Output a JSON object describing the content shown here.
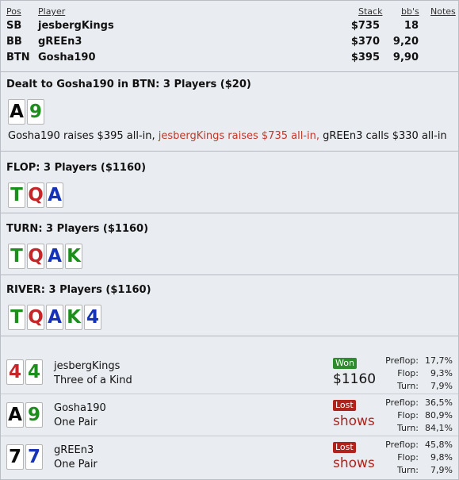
{
  "headers": {
    "pos": "Pos",
    "player": "Player",
    "stack": "Stack",
    "bbs": "bb's",
    "notes": "Notes"
  },
  "players": [
    {
      "pos": "SB",
      "name": "jesbergKings",
      "stack": "$735",
      "bbs": "18"
    },
    {
      "pos": "BB",
      "name": "gREEn3",
      "stack": "$370",
      "bbs": "9,20"
    },
    {
      "pos": "BTN",
      "name": "Gosha190",
      "stack": "$395",
      "bbs": "9,90"
    }
  ],
  "preflop": {
    "title": "Dealt to Gosha190 in BTN: 3 Players ($20)",
    "cards": [
      {
        "rank": "A",
        "color": "black"
      },
      {
        "rank": "9",
        "color": "green"
      }
    ],
    "actions": [
      {
        "text": "Gosha190 raises $395 all-in, ",
        "style": "normal"
      },
      {
        "text": "jesbergKings raises $735 all-in, ",
        "style": "red"
      },
      {
        "text": "gREEn3 calls $330 all-in",
        "style": "normal"
      }
    ]
  },
  "flop": {
    "title": "FLOP: 3 Players ($1160)",
    "cards": [
      {
        "rank": "T",
        "color": "green"
      },
      {
        "rank": "Q",
        "color": "red"
      },
      {
        "rank": "A",
        "color": "blue"
      }
    ]
  },
  "turn": {
    "title": "TURN: 3 Players ($1160)",
    "cards": [
      {
        "rank": "T",
        "color": "green"
      },
      {
        "rank": "Q",
        "color": "red"
      },
      {
        "rank": "A",
        "color": "blue"
      },
      {
        "rank": "K",
        "color": "green"
      }
    ]
  },
  "river": {
    "title": "RIVER: 3 Players ($1160)",
    "cards": [
      {
        "rank": "T",
        "color": "green"
      },
      {
        "rank": "Q",
        "color": "red"
      },
      {
        "rank": "A",
        "color": "blue"
      },
      {
        "rank": "K",
        "color": "green"
      },
      {
        "rank": "4",
        "color": "blue"
      }
    ]
  },
  "results": [
    {
      "name": "jesbergKings",
      "hand": "Three of a Kind",
      "cards": [
        {
          "rank": "4",
          "color": "red"
        },
        {
          "rank": "4",
          "color": "green"
        }
      ],
      "badge": "Won",
      "outcome": "won",
      "amount": "$1160",
      "stats": [
        {
          "label": "Preflop:",
          "value": "17,7%"
        },
        {
          "label": "Flop:",
          "value": "9,3%"
        },
        {
          "label": "Turn:",
          "value": "7,9%"
        }
      ]
    },
    {
      "name": "Gosha190",
      "hand": "One Pair",
      "cards": [
        {
          "rank": "A",
          "color": "black"
        },
        {
          "rank": "9",
          "color": "green"
        }
      ],
      "badge": "Lost",
      "outcome": "lost",
      "amount": "shows",
      "stats": [
        {
          "label": "Preflop:",
          "value": "36,5%"
        },
        {
          "label": "Flop:",
          "value": "80,9%"
        },
        {
          "label": "Turn:",
          "value": "84,1%"
        }
      ]
    },
    {
      "name": "gREEn3",
      "hand": "One Pair",
      "cards": [
        {
          "rank": "7",
          "color": "black"
        },
        {
          "rank": "7",
          "color": "blue"
        }
      ],
      "badge": "Lost",
      "outcome": "lost",
      "amount": "shows",
      "stats": [
        {
          "label": "Preflop:",
          "value": "45,8%"
        },
        {
          "label": "Flop:",
          "value": "9,8%"
        },
        {
          "label": "Turn:",
          "value": "7,9%"
        }
      ]
    }
  ],
  "colors": {
    "green": "#1b8e1b",
    "blue": "#1633b8",
    "red": "#c4262a",
    "black": "#0a0a0a",
    "won": "#2e8b2e",
    "lost": "#b0221c"
  }
}
